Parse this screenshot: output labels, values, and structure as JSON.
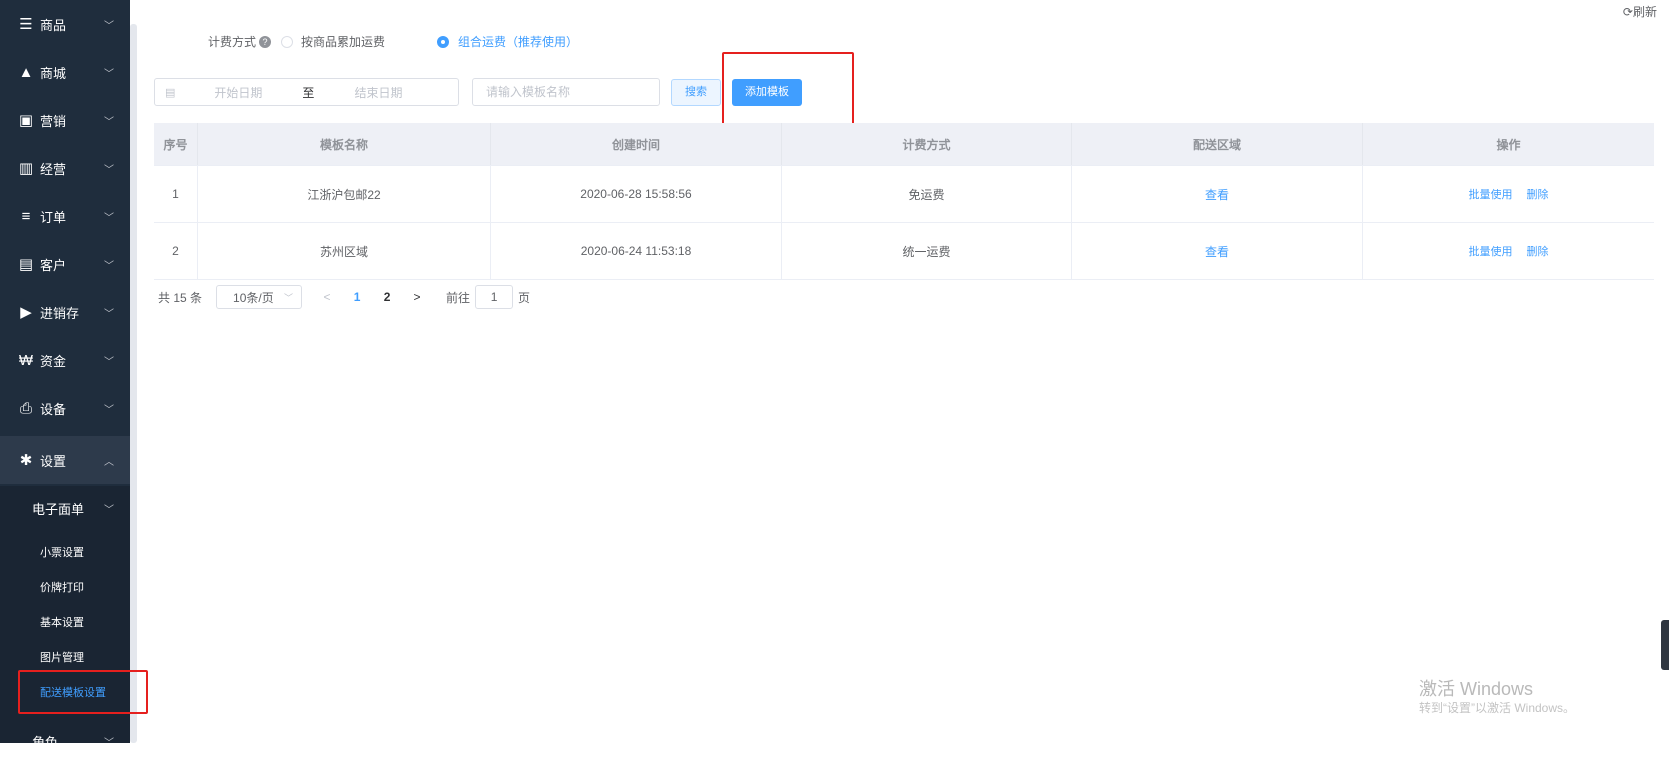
{
  "sidebar": {
    "items": [
      {
        "label": "商品",
        "icon": "menu-icon",
        "glyph": "☰"
      },
      {
        "label": "商城",
        "icon": "shopping-bag-icon",
        "glyph": "▲"
      },
      {
        "label": "营销",
        "icon": "gift-icon",
        "glyph": "▣"
      },
      {
        "label": "经营",
        "icon": "bar-chart-icon",
        "glyph": "▥"
      },
      {
        "label": "订单",
        "icon": "list-icon",
        "glyph": "≡"
      },
      {
        "label": "客户",
        "icon": "id-card-icon",
        "glyph": "▤"
      },
      {
        "label": "进销存",
        "icon": "truck-icon",
        "glyph": "▶"
      },
      {
        "label": "资金",
        "icon": "won-icon",
        "glyph": "₩"
      },
      {
        "label": "设备",
        "icon": "printer-icon",
        "glyph": "⎙"
      },
      {
        "label": "设置",
        "icon": "gear-icon",
        "glyph": "✱"
      }
    ],
    "submenu_group": "电子面单",
    "submenu": [
      "小票设置",
      "价牌打印",
      "基本设置",
      "图片管理",
      "配送模板设置"
    ],
    "bottom_item": "角色"
  },
  "header": {
    "refresh": "刷新"
  },
  "fee_mode": {
    "label": "计费方式",
    "options": [
      {
        "label": "按商品累加运费",
        "selected": false
      },
      {
        "label": "组合运费（推荐使用）",
        "selected": true
      }
    ]
  },
  "filters": {
    "start_placeholder": "开始日期",
    "separator": "至",
    "end_placeholder": "结束日期",
    "name_placeholder": "请输入模板名称",
    "search_label": "搜索",
    "add_label": "添加模板"
  },
  "table": {
    "columns": [
      "序号",
      "模板名称",
      "创建时间",
      "计费方式",
      "配送区域",
      "操作"
    ],
    "rows": [
      {
        "no": "1",
        "name": "江浙沪包邮22",
        "created": "2020-06-28 15:58:56",
        "fee": "免运费",
        "area": "查看",
        "op1": "批量使用",
        "op2": "删除"
      },
      {
        "no": "2",
        "name": "苏州区域",
        "created": "2020-06-24 11:53:18",
        "fee": "统一运费",
        "area": "查看",
        "op1": "批量使用",
        "op2": "删除"
      }
    ]
  },
  "pagination": {
    "total": "共 15 条",
    "page_size": "10条/页",
    "pages": [
      "1",
      "2"
    ],
    "goto_label": "前往",
    "goto_value": "1",
    "page_unit": "页"
  },
  "watermark": {
    "line1": "激活 Windows",
    "line2": "转到“设置”以激活 Windows。"
  },
  "colors": {
    "sidebar_bg": "#1f2d3d",
    "accent": "#409eff",
    "highlight": "#e5201e"
  }
}
